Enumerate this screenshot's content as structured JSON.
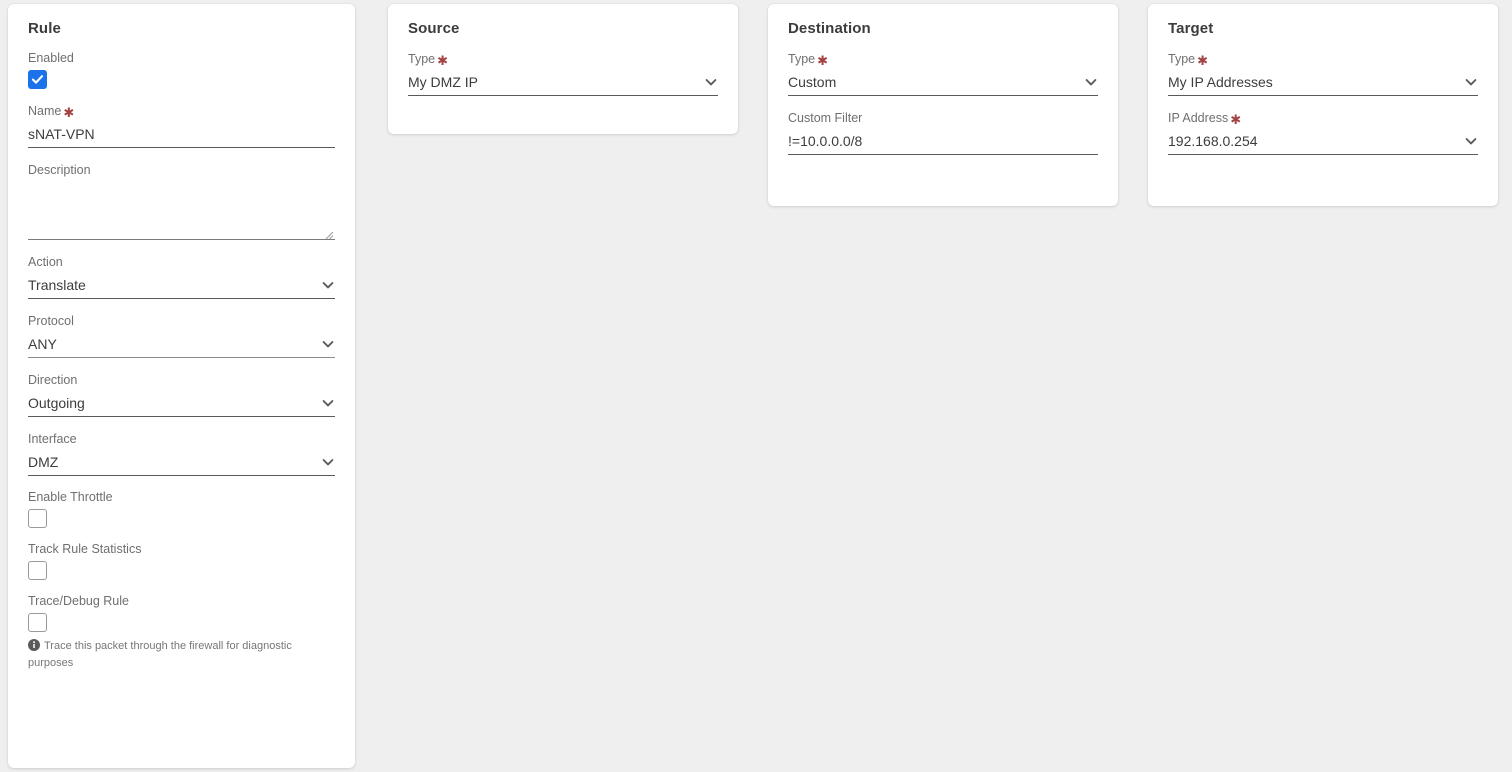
{
  "cards": {
    "rule": {
      "title": "Rule",
      "fields": {
        "enabled": {
          "label": "Enabled",
          "checked": true
        },
        "name": {
          "label": "Name",
          "required": true,
          "value": "sNAT-VPN"
        },
        "description": {
          "label": "Description",
          "value": "",
          "placeholder": ""
        },
        "action": {
          "label": "Action",
          "value": "Translate"
        },
        "protocol": {
          "label": "Protocol",
          "value": "ANY"
        },
        "direction": {
          "label": "Direction",
          "value": "Outgoing"
        },
        "interface": {
          "label": "Interface",
          "value": "DMZ"
        },
        "enable_throttle": {
          "label": "Enable Throttle",
          "checked": false
        },
        "track_rule_statistics": {
          "label": "Track Rule Statistics",
          "checked": false
        },
        "trace_debug_rule": {
          "label": "Trace/Debug Rule",
          "checked": false
        }
      },
      "hint": "Trace this packet through the firewall for diagnostic purposes"
    },
    "source": {
      "title": "Source",
      "fields": {
        "type": {
          "label": "Type",
          "required": true,
          "value": "My DMZ IP"
        }
      }
    },
    "destination": {
      "title": "Destination",
      "fields": {
        "type": {
          "label": "Type",
          "required": true,
          "value": "Custom"
        },
        "custom_filter": {
          "label": "Custom Filter",
          "value": "!=10.0.0.0/8"
        }
      }
    },
    "target": {
      "title": "Target",
      "fields": {
        "type": {
          "label": "Type",
          "required": true,
          "value": "My IP Addresses"
        },
        "ip_address": {
          "label": "IP Address",
          "required": true,
          "value": "192.168.0.254"
        }
      }
    }
  },
  "icons": {
    "chevron": "chevron-down-icon",
    "info": "info-icon",
    "check": "check-icon",
    "resize": "resize-grip-icon"
  },
  "colors": {
    "background": "#efefef",
    "card": "#ffffff",
    "accent": "#1a73e8",
    "required": "#a34242",
    "label": "#6f6f6f",
    "value": "#3d3d3d"
  }
}
